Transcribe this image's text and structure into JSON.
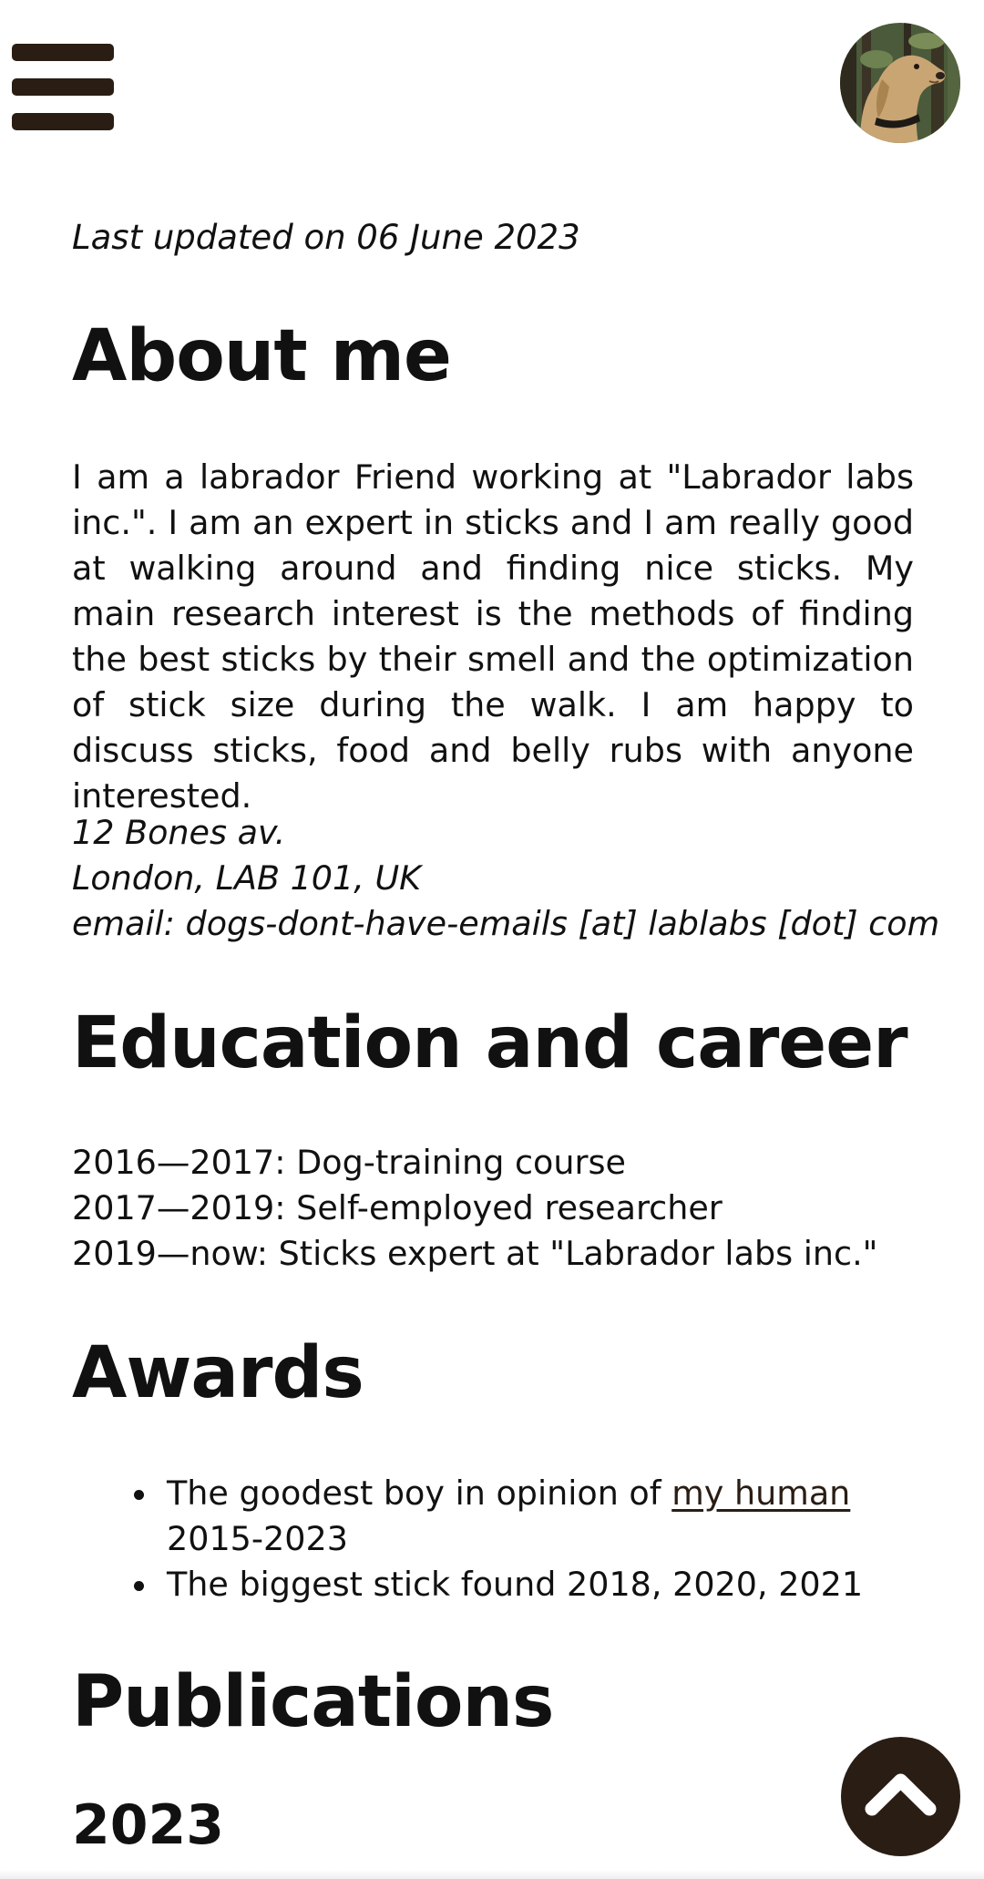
{
  "header": {
    "menu_icon": "hamburger-menu-icon",
    "avatar_icon": "labrador-avatar"
  },
  "last_updated": "Last updated on 06 June 2023",
  "about": {
    "heading": "About me",
    "bio": "I am a labrador Friend working at \"Labrador labs inc.\". I am an expert in sticks and I am really good at walking around and finding nice sticks. My main research interest is the methods of finding the best sticks by their smell and the optimization of stick size during the walk. I am happy to discuss sticks, food and belly rubs with anyone interested.",
    "address": [
      "12 Bones av.",
      "London, LAB 101, UK",
      "email: dogs-dont-have-emails [at] lablabs [dot] com"
    ]
  },
  "education": {
    "heading": "Education and career",
    "entries": [
      "2016—2017: Dog-training course",
      "2017—2019: Self-employed researcher",
      "2019—now: Sticks expert at \"Labrador labs inc.\""
    ]
  },
  "awards": {
    "heading": "Awards",
    "items": [
      {
        "prefix": "The goodest boy in opinion of ",
        "link": "my human",
        "suffix": "2015-2023"
      },
      {
        "text": "The biggest stick found 2018, 2020, 2021"
      }
    ]
  },
  "publications": {
    "heading": "Publications",
    "year": "2023"
  },
  "scroll_top": {
    "icon": "chevron-up-icon"
  },
  "colors": {
    "accent": "#2a1d14",
    "text": "#111111",
    "background": "#ffffff"
  }
}
